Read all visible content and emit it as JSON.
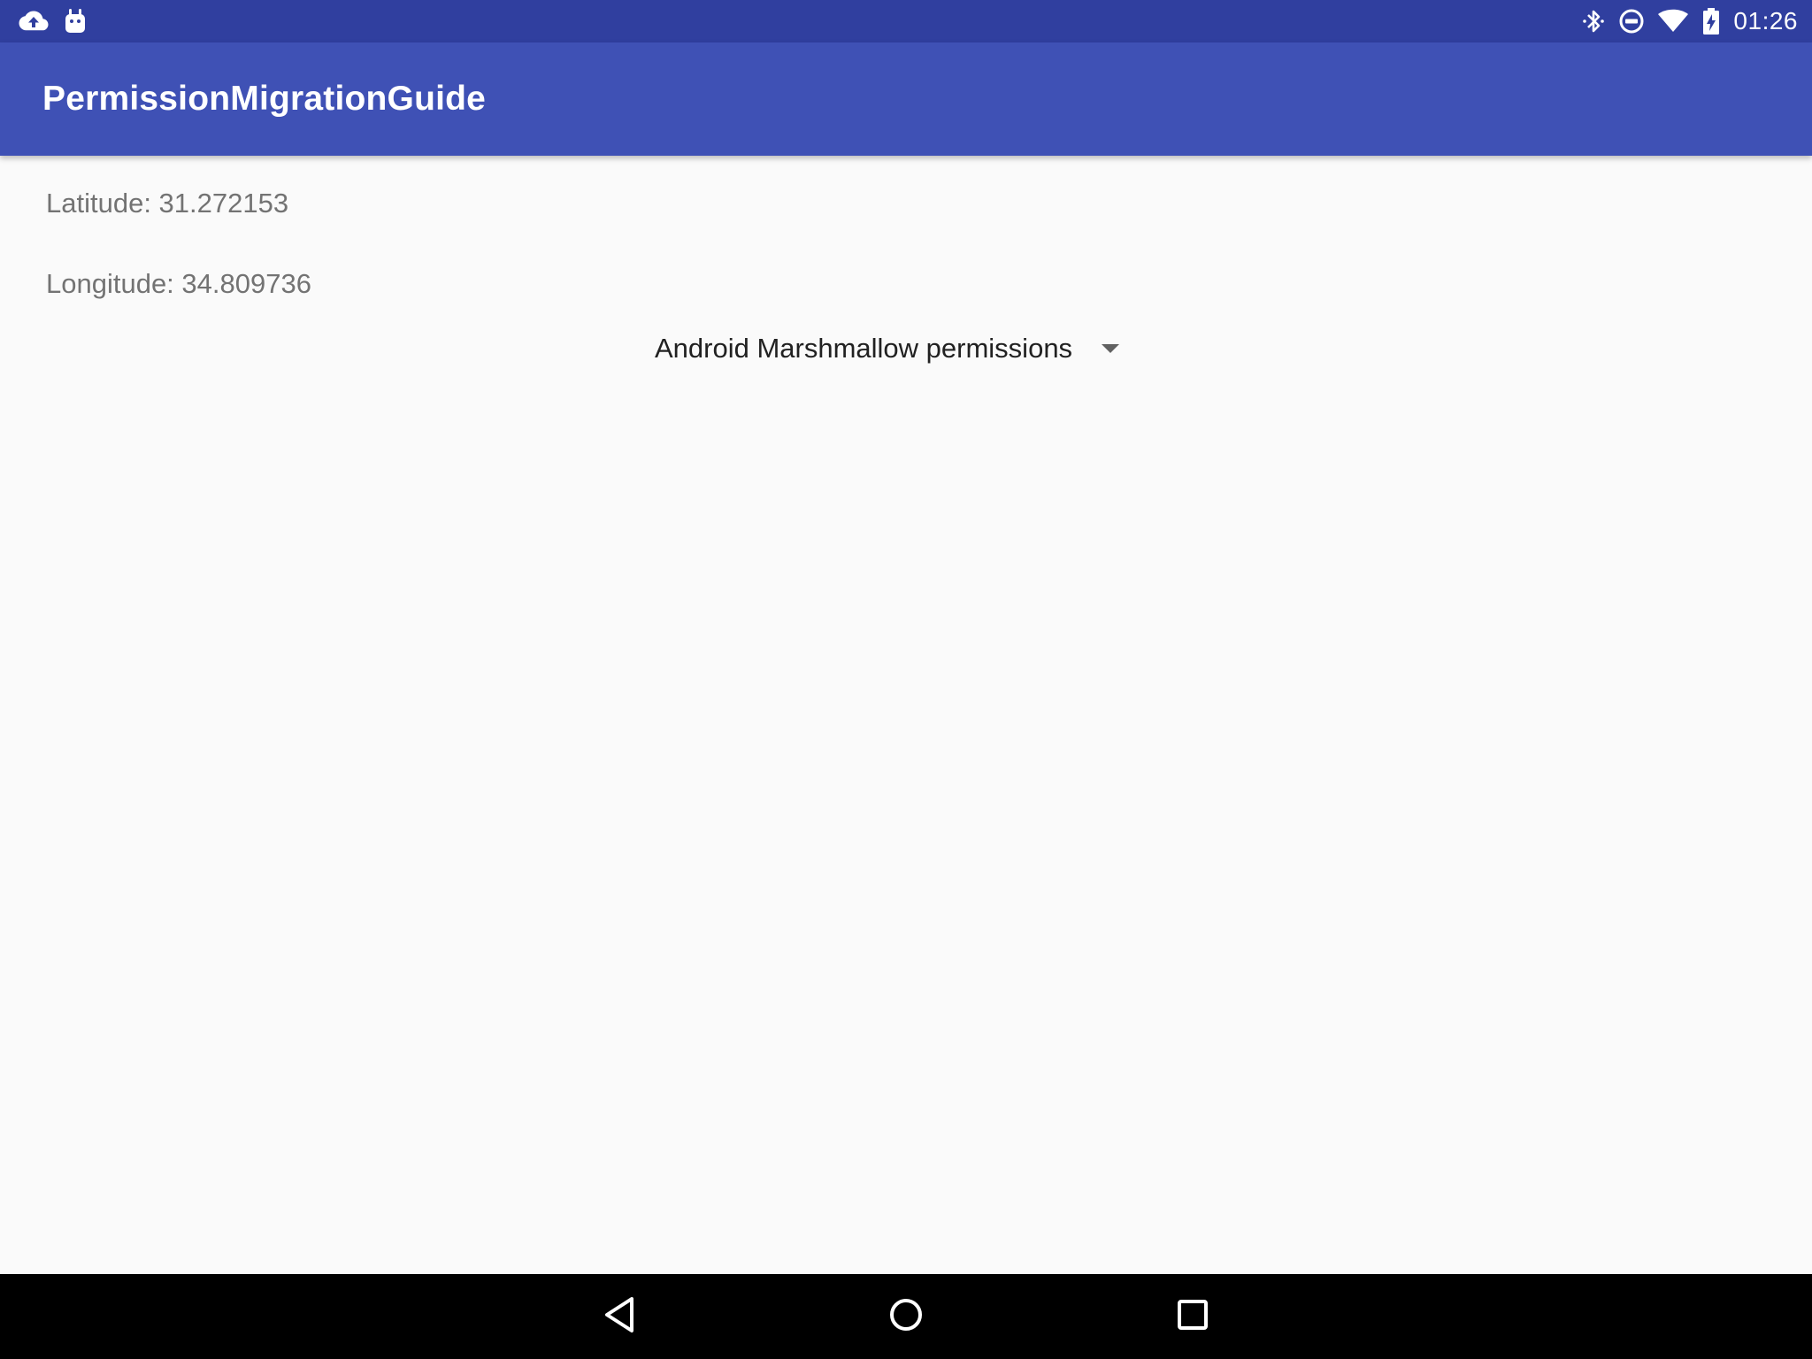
{
  "status_bar": {
    "time": "01:26",
    "left_icons": [
      "cloud-upload-icon",
      "android-icon"
    ],
    "right_icons": [
      "bluetooth-icon",
      "do-not-disturb-icon",
      "wifi-icon",
      "battery-charging-icon"
    ],
    "background": "#303f9f"
  },
  "app_bar": {
    "title": "PermissionMigrationGuide",
    "background": "#3f51b5"
  },
  "location": {
    "latitude_text": "Latitude: 31.272153",
    "longitude_text": "Longitude: 34.809736"
  },
  "spinner": {
    "selected": "Android Marshmallow permissions",
    "icon": "dropdown-arrow-icon"
  },
  "nav_bar": {
    "buttons": [
      "back-icon",
      "home-icon",
      "recents-icon"
    ],
    "background": "#000000"
  }
}
